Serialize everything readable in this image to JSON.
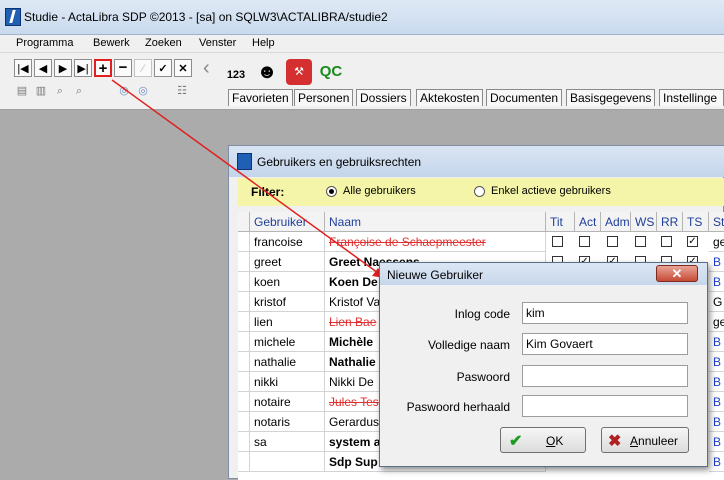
{
  "window": {
    "title": "Studie - ActaLibra  SDP ©2013 - [sa]  on  SQLW3\\ACTALIBRA/studie2"
  },
  "menu": [
    "Programma",
    "Bewerk",
    "Zoeken",
    "Venster",
    "Help"
  ],
  "toolbar": {
    "nav": [
      "|◀",
      "◀",
      "▶",
      "▶|",
      "+",
      "−",
      "⁄",
      "✓",
      "✕"
    ],
    "big_icons": [
      "123",
      "QC"
    ],
    "tabs": [
      "Favorieten",
      "Personen",
      "Dossiers",
      "Aktekosten",
      "Documenten",
      "Basisgegevens",
      "Instellinge"
    ]
  },
  "child": {
    "title": "Gebruikers en gebruiksrechten",
    "filter_label": "Filter:",
    "filter_options": [
      "Alle gebruikers",
      "Enkel actieve gebruikers"
    ],
    "columns": [
      "Gebruiker",
      "Naam",
      "Tit",
      "Act",
      "Adm",
      "WS",
      "RR",
      "TS",
      "St"
    ],
    "rows": [
      {
        "user": "francoise",
        "name": "Françoise de Schaepmeester",
        "style": "strike",
        "extra": "ge"
      },
      {
        "user": "greet",
        "name": "Greet Naessens",
        "style": "bold",
        "extra": "B"
      },
      {
        "user": "koen",
        "name": "Koen De",
        "style": "bold",
        "extra": "B"
      },
      {
        "user": "kristof",
        "name": "Kristof Va",
        "style": "normal",
        "extra": "G"
      },
      {
        "user": "lien",
        "name": "Lien Bae",
        "style": "strike",
        "extra": "ge"
      },
      {
        "user": "michele",
        "name": "Michèle",
        "style": "bold",
        "extra": "B"
      },
      {
        "user": "nathalie",
        "name": "Nathalie",
        "style": "bold",
        "extra": "B"
      },
      {
        "user": "nikki",
        "name": "Nikki De",
        "style": "normal",
        "extra": "B"
      },
      {
        "user": "notaire",
        "name": "Jules Tes",
        "style": "strike",
        "extra": "B"
      },
      {
        "user": "notaris",
        "name": "Gerardus",
        "style": "normal",
        "extra": "B"
      },
      {
        "user": "sa",
        "name": "system a",
        "style": "bold",
        "extra": "B"
      },
      {
        "user": "",
        "name": "Sdp Sup",
        "style": "bold",
        "extra": "B"
      }
    ]
  },
  "dialog": {
    "title": "Nieuwe Gebruiker",
    "close": "✕",
    "fields": [
      {
        "label": "Inlog code",
        "value": "kim"
      },
      {
        "label": "Volledige naam",
        "value": "Kim Govaert"
      },
      {
        "label": "Paswoord",
        "value": ""
      },
      {
        "label": "Paswoord herhaald",
        "value": ""
      }
    ],
    "ok_label": "OK",
    "cancel_label": "Annuleer"
  },
  "colors": {
    "annotation_arrow": "#e02020",
    "filter_bg": "#f4f5a8",
    "header_text": "#1f3f99"
  }
}
